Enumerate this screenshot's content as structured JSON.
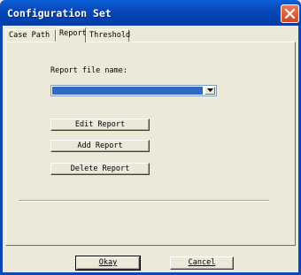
{
  "window": {
    "title": "Configuration Set",
    "close_icon": "close-icon"
  },
  "tabs": [
    {
      "label": "Case Path",
      "active": false
    },
    {
      "label": "Report",
      "active": true
    },
    {
      "label": "Threshold",
      "active": false
    }
  ],
  "report": {
    "file_label": "Report file name:",
    "file_value": "",
    "edit_label": "Edit Report",
    "add_label": "Add Report",
    "delete_label": "Delete Report"
  },
  "footer": {
    "okay_label": "Okay",
    "cancel_label": "Cancel"
  },
  "colors": {
    "title_bar": "#0848b8",
    "selection": "#316ac5",
    "close_button": "#d2471f"
  }
}
